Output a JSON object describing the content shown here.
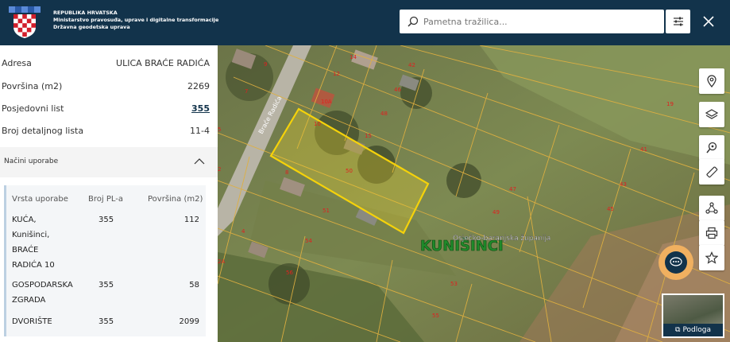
{
  "header": {
    "org_line1": "REPUBLIKA HRVATSKA",
    "org_line2": "Ministarstvo pravosuđa, uprave i digitalne transformacije",
    "org_line3": "Državna geodetska uprava",
    "search_placeholder": "Pametna tražilica..."
  },
  "parcel": {
    "rows": [
      {
        "label": "Adresa",
        "value": "ULICA BRAĆE RADIĆA"
      },
      {
        "label": "Površina (m2)",
        "value": "2269"
      },
      {
        "label": "Posjedovni list",
        "value": "355"
      },
      {
        "label": "Broj detaljnog lista",
        "value": "11-4"
      }
    ]
  },
  "usage": {
    "section_title": "Načini uporabe",
    "columns": [
      "Vrsta uporabe",
      "Broj PL-a",
      "Površina (m2)"
    ],
    "rows": [
      {
        "type": [
          "KUĆA,",
          "Kunišinci,",
          "BRAĆE",
          "RADIĆA 10"
        ],
        "pl": "355",
        "area": "112"
      },
      {
        "type": [
          "GOSPODARSKA",
          "ZGRADA"
        ],
        "pl": "355",
        "area": "58"
      },
      {
        "type": [
          "DVORIŠTE"
        ],
        "pl": "355",
        "area": "2099"
      }
    ]
  },
  "map": {
    "street_label": "Braće Radića",
    "settlement_label": "KUNIŠINCI",
    "county_label": "Osječko-baranjska županija",
    "parcel_numbers": [
      "9",
      "14",
      "7",
      "12",
      "42",
      "46",
      "10A",
      "10",
      "48",
      "15",
      "19",
      "41",
      "8",
      "50",
      "43",
      "47",
      "45",
      "49",
      "5",
      "2",
      "4",
      "51",
      "54",
      "56",
      "2A",
      "53",
      "55"
    ],
    "basemap_label": "Podloga"
  },
  "colors": {
    "header_bg": "#12334b",
    "parcel_highlight": "#f5d20a",
    "parcel_lines": "#e0b040"
  }
}
